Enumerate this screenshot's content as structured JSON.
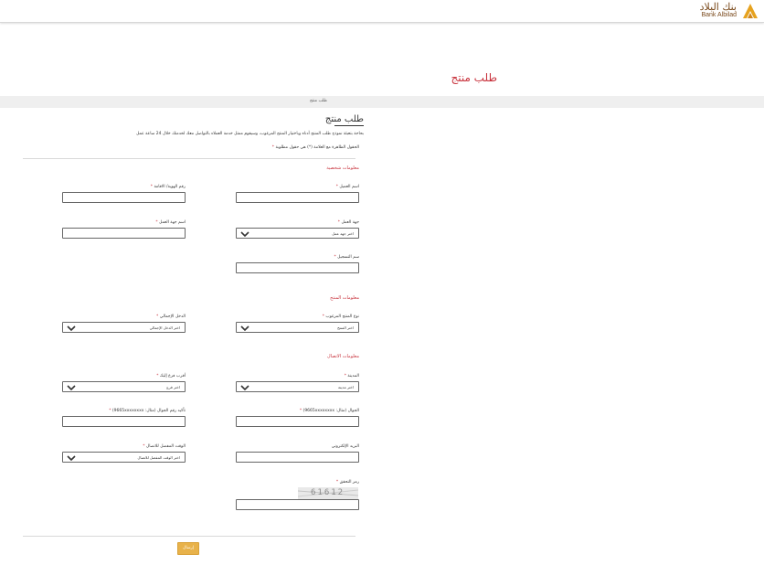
{
  "header": {
    "logo_ar": "بنك البلاد",
    "logo_en": "Bank Albilad"
  },
  "page": {
    "title": "طلب منتج",
    "breadcrumb": "طلب منتج"
  },
  "form": {
    "title": "طلب منتج",
    "intro": "بحاجة بتعبئة نموذج طلب المنتج أدناه وباختيار المنتج المرغوب، وسيقوم ممثل خدمة العملاء بالتواصل معك لخدمتك خلال 24 ساعة عمل",
    "required_note": "الحقول الظاهرة مع العلامة (*) هي حقول مطلوبة",
    "required_mark": "*",
    "sections": {
      "personal": "معلومات شخصية",
      "product": "معلومات المنتج",
      "contact": "معلومات الاتصال"
    },
    "fields": {
      "customer_name": "اسم العميل",
      "id_number": "رقم الهوية/ الاقامة",
      "employer_type": "جهة العمل",
      "employer_name": "اسم جهة العمل",
      "employer_type_placeholder": "اختر جهة عمل",
      "registration_name": "سم التسجيل",
      "product_type": "نوع المنتج المرغوب",
      "product_type_placeholder": "اختر المنتج",
      "total_income": "الدخل الإجمالي",
      "total_income_placeholder": "اختر الدخل الإجمالي",
      "city": "المدينة",
      "city_placeholder": "اختر مدينة",
      "branch": "أقرب فرع إليك",
      "branch_placeholder": "اختر فرع",
      "mobile": "الجوال (مثال: 9665xxxxxxxx)",
      "mobile_confirm": "تأكيد رقم الجوال (مثال: 9665xxxxxxxx)",
      "email": "البريد الإلكتروني",
      "contact_time": "الوقت المفضل للاتصال",
      "contact_time_placeholder": "اختر الوقت المفضل للاتصال",
      "captcha": "رمز التحقق",
      "captcha_value": "61612"
    },
    "submit": "إرسال"
  }
}
